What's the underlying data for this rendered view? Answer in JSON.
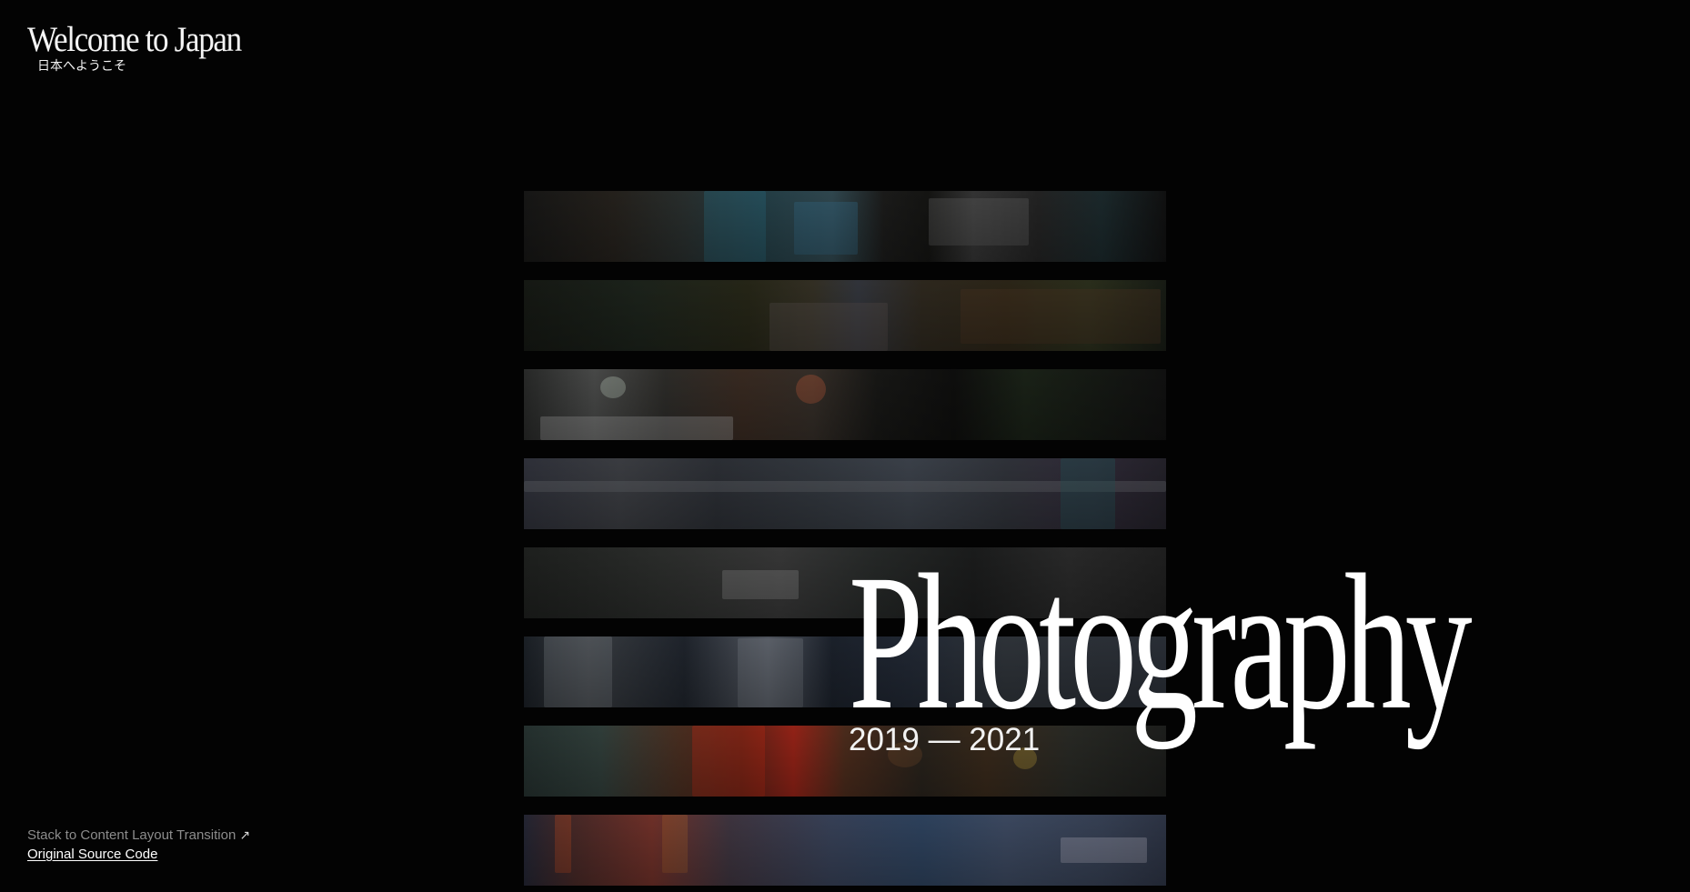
{
  "brand": {
    "title": "Welcome to Japan",
    "subtitle": "日本へようこそ"
  },
  "hero": {
    "title": "Photography",
    "years": "2019 — 2021"
  },
  "footer": {
    "demo_link_label": "Stack to Content Layout Transition",
    "demo_link_icon": "arrow-up-right-icon",
    "source_link_label": "Original Source Code"
  },
  "colors": {
    "background": "#030303",
    "text": "#ffffff",
    "muted_text": "#8c8c8c"
  }
}
